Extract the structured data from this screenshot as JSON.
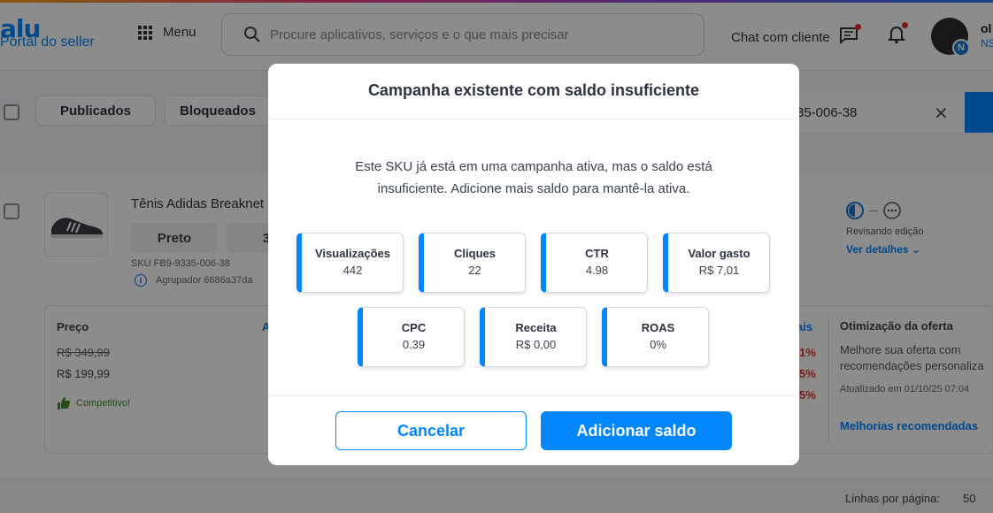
{
  "header": {
    "logo_text": "alu",
    "portal_label": "Portal do seller",
    "menu_label": "Menu",
    "search_placeholder": "Procure aplicativos, serviços e o que mais precisar",
    "chat_label": "Chat com cliente",
    "avatar_badge": "N",
    "user_name": "ol",
    "user_sub": "NS"
  },
  "filters": {
    "chips": [
      "Publicados",
      "Bloqueados"
    ],
    "sku_search_value": "35-006-38"
  },
  "product": {
    "title": "Tênis Adidas Breaknet",
    "variants": [
      "Preto",
      "3"
    ],
    "sku_line": "SKU  FB9-9335-006-38",
    "agrupador_line": "Agrupador  6686a37da",
    "review_status": "Revisando edição",
    "review_link": "Ver detalhes"
  },
  "price_panel": {
    "heading": "Preço",
    "side_letter": "A",
    "old_price": "R$ 349,99",
    "new_price": "R$ 199,99",
    "competitive_label": "Competitivo!"
  },
  "stats_panel": {
    "partial_label": "ais",
    "pcts": [
      "1%",
      "5%",
      "5%"
    ]
  },
  "optimization": {
    "heading": "Otimização da oferta",
    "description": "Melhore sua oferta com recomendações personaliza",
    "updated": "Atualizado em 01/10/25 07:04",
    "link": "Melhorias recomendadas"
  },
  "pagination": {
    "rows_label": "Linhas por página:",
    "rows_value": "50"
  },
  "modal": {
    "title": "Campanha existente com saldo insuficiente",
    "message": "Este SKU já está em uma campanha ativa, mas o saldo está insuficiente. Adicione mais saldo para mantê-la ativa.",
    "metrics": [
      {
        "label": "Visualizações",
        "value": "442"
      },
      {
        "label": "Cliques",
        "value": "22"
      },
      {
        "label": "CTR",
        "value": "4.98"
      },
      {
        "label": "Valor gasto",
        "value": "R$ 7,01"
      },
      {
        "label": "CPC",
        "value": "0.39"
      },
      {
        "label": "Receita",
        "value": "R$ 0,00"
      },
      {
        "label": "ROAS",
        "value": "0%"
      }
    ],
    "cancel_label": "Cancelar",
    "confirm_label": "Adicionar saldo"
  }
}
